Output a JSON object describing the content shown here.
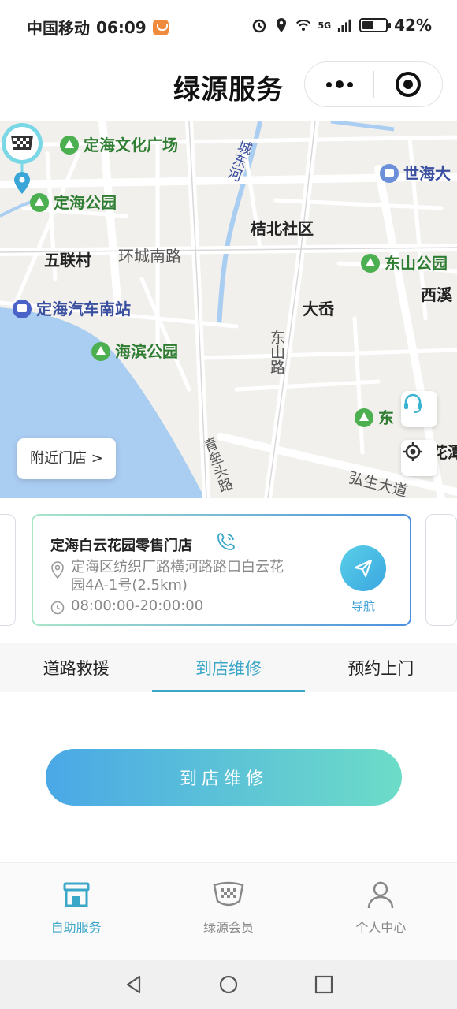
{
  "status_bar": {
    "carrier": "中国移动",
    "time": "06:09",
    "network": "5G",
    "battery": "42%",
    "battery_level": 0.42
  },
  "header": {
    "title": "绿源服务",
    "more_icon": "more-dots-icon",
    "close_icon": "target-close-icon"
  },
  "map": {
    "labels": [
      {
        "text": "定海文化广场",
        "style": "green"
      },
      {
        "text": "定海公园",
        "style": "green"
      },
      {
        "text": "五联村",
        "style": "plain"
      },
      {
        "text": "环城南路",
        "style": "gray"
      },
      {
        "text": "桔北社区",
        "style": "plain"
      },
      {
        "text": "东山公园",
        "style": "green"
      },
      {
        "text": "西溪",
        "style": "plain"
      },
      {
        "text": "定海汽车南站",
        "style": "blue"
      },
      {
        "text": "大岙",
        "style": "plain"
      },
      {
        "text": "海滨公园",
        "style": "green"
      },
      {
        "text": "世海大",
        "style": "blue"
      },
      {
        "text": "东山路",
        "style": "gray"
      },
      {
        "text": "城东河",
        "style": "blue"
      },
      {
        "text": "青垒头路",
        "style": "gray"
      },
      {
        "text": "弘生大道",
        "style": "gray"
      },
      {
        "text": "东",
        "style": "green"
      },
      {
        "text": "花潭",
        "style": "plain"
      }
    ],
    "nearby_button": "附近门店 >",
    "service_icon": "headset-icon",
    "locate_icon": "locate-icon"
  },
  "store": {
    "name": "定海白云花园零售门店",
    "address": "定海区纺织厂路横河路路口白云花园4A-1号(2.5km)",
    "hours": "08:00:00-20:00:00",
    "nav_label": "导航"
  },
  "tabs": [
    {
      "label": "道路救援",
      "active": false
    },
    {
      "label": "到店维修",
      "active": true
    },
    {
      "label": "预约上门",
      "active": false
    }
  ],
  "action": {
    "label": "到店维修"
  },
  "tabbar": [
    {
      "label": "自助服务",
      "icon": "store-icon",
      "active": true
    },
    {
      "label": "绿源会员",
      "icon": "member-badge-icon",
      "active": false
    },
    {
      "label": "个人中心",
      "icon": "person-icon",
      "active": false
    }
  ],
  "colors": {
    "accent": "#3aa6c8",
    "button_gradient_start": "#4aa8e6",
    "button_gradient_end": "#6ddcc8"
  }
}
